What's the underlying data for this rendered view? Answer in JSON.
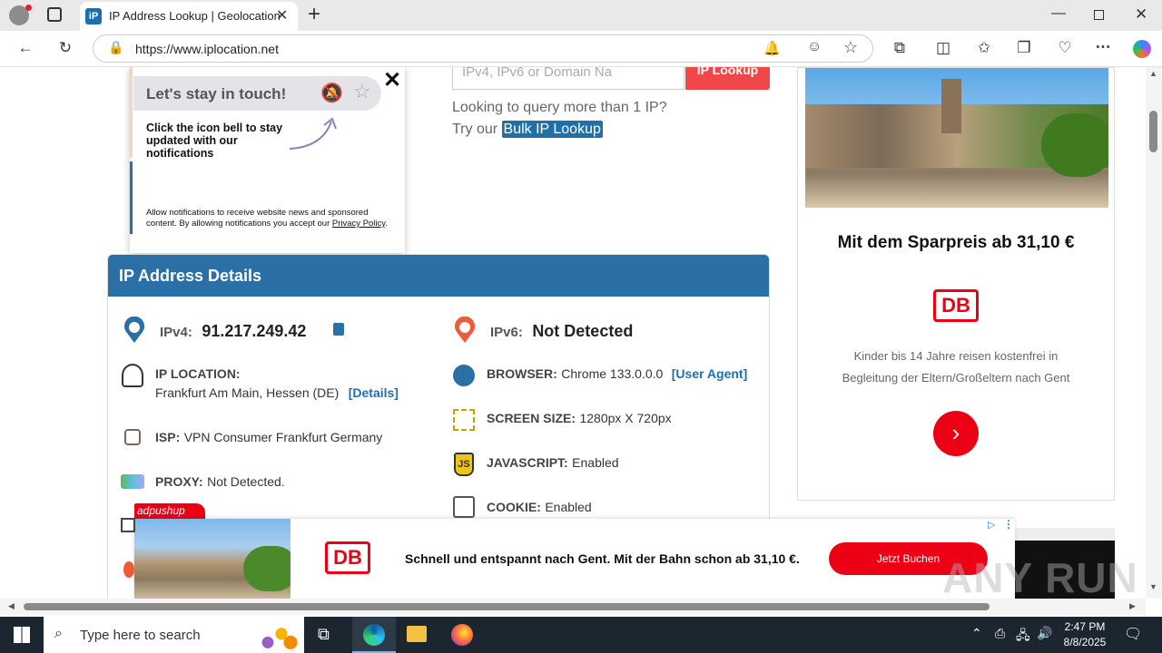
{
  "browser": {
    "tab_title": "IP Address Lookup | Geolocation",
    "url": "https://www.iplocation.net",
    "new_tab_label": "+"
  },
  "search": {
    "placeholder": "IPv4, IPv6 or Domain Na",
    "button_label": "IP Lookup",
    "bulk_prompt": "Looking to query more than 1 IP?",
    "try_text": "Try our",
    "bulk_link": "Bulk IP Lookup"
  },
  "popup": {
    "title": "Let's stay in touch!",
    "message": "Click the icon bell to stay updated with our notifications",
    "fineprint": "Allow notifications to receive website news and sponsored content. By allowing notifications you accept our",
    "policy_link": "Privacy Policy",
    "fineprint_end": "."
  },
  "details": {
    "header": "IP Address Details",
    "ipv4_label": "IPv4:",
    "ipv4_value": "91.217.249.42",
    "ipv6_label": "IPv6:",
    "ipv6_value": "Not Detected",
    "location_label": "IP LOCATION:",
    "location_value": "Frankfurt Am Main, Hessen (DE)",
    "location_link": "[Details]",
    "browser_label": "BROWSER:",
    "browser_value": "Chrome 133.0.0.0",
    "browser_link": "[User Agent]",
    "isp_label": "ISP:",
    "isp_value": "VPN Consumer Frankfurt Germany",
    "screen_label": "SCREEN SIZE:",
    "screen_value": "1280px X 720px",
    "proxy_label": "PROXY:",
    "proxy_value": "Not Detected.",
    "js_label": "JAVASCRIPT:",
    "js_value": "Enabled",
    "cookie_label": "COOKIE:",
    "cookie_value": "Enabled"
  },
  "side_ad": {
    "headline": "Mit dem Sparpreis ab 31,10 €",
    "logo": "DB",
    "text": "Kinder bis 14 Jahre reisen kostenfrei in Begleitung der Eltern/Großeltern nach Gent"
  },
  "bottom_ad": {
    "badge": "adpushup",
    "logo": "DB",
    "text": "Schnell und entspannt nach Gent. Mit der Bahn schon ab 31,10 €.",
    "cta": "Jetzt Buchen"
  },
  "watermark": "ANY RUN",
  "taskbar": {
    "search_placeholder": "Type here to search",
    "time": "2:47 PM",
    "date": "8/8/2025"
  },
  "colors": {
    "header_blue": "#2a6fa6",
    "db_red": "#ec0016",
    "link_blue": "#1e6fb0",
    "lookup_red": "#f0474a"
  }
}
